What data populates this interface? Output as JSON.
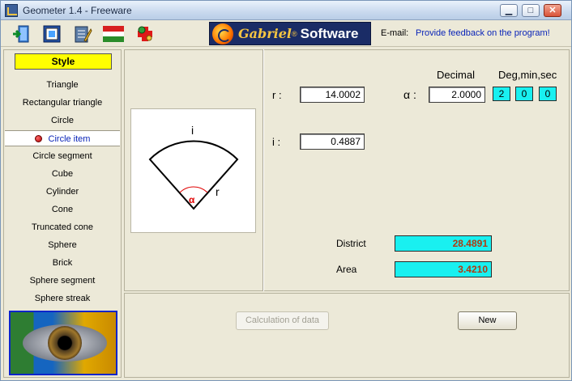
{
  "window": {
    "title": "Geometer 1.4 - Freeware",
    "controls": [
      "minimize",
      "maximize",
      "close"
    ]
  },
  "toolbar": {
    "tools": [
      "exit-icon",
      "fit-icon",
      "notepad-icon",
      "hungarian-flag-icon",
      "help-icon"
    ]
  },
  "banner": {
    "name": "Gabriel",
    "registered": "®",
    "suffix": "Software"
  },
  "contact": {
    "email_label": "E-mail:",
    "feedback_link": "Provide feedback on the program!"
  },
  "sidebar": {
    "style_label": "Style",
    "items": [
      {
        "label": "Triangle",
        "selected": false
      },
      {
        "label": "Rectangular triangle",
        "selected": false
      },
      {
        "label": "Circle",
        "selected": false
      },
      {
        "label": "Circle item",
        "selected": true
      },
      {
        "label": "Circle segment",
        "selected": false
      },
      {
        "label": "Cube",
        "selected": false
      },
      {
        "label": "Cylinder",
        "selected": false
      },
      {
        "label": "Cone",
        "selected": false
      },
      {
        "label": "Truncated cone",
        "selected": false
      },
      {
        "label": "Sphere",
        "selected": false
      },
      {
        "label": "Brick",
        "selected": false
      },
      {
        "label": "Sphere segment",
        "selected": false
      },
      {
        "label": "Sphere streak",
        "selected": false
      }
    ]
  },
  "figure": {
    "arc_label": "i",
    "radius_label": "r",
    "angle_label": "α"
  },
  "inputs": {
    "r_label": "r :",
    "r_value": "14.0002",
    "i_label": "i :",
    "i_value": "0.4887",
    "alpha_label": "α :",
    "alpha_value": "2.0000",
    "decimal_header": "Decimal",
    "dms_header": "Deg,min,sec",
    "deg": "2",
    "min": "0",
    "sec": "0"
  },
  "results": {
    "district_label": "District",
    "district_value": "28.4891",
    "area_label": "Area",
    "area_value": "3.4210"
  },
  "buttons": {
    "calculate": "Calculation of data",
    "new": "New"
  },
  "colors": {
    "style_box": "#ffff00",
    "cyan_field": "#19f0f0",
    "result_text": "#b03a12",
    "link": "#0a24b8",
    "figure_red": "#e00000"
  }
}
